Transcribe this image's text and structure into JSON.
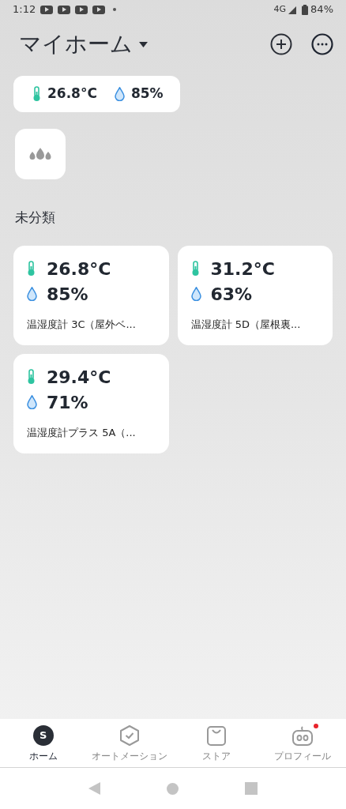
{
  "status_bar": {
    "time": "1:12",
    "notifications": [
      {
        "kind": "video"
      },
      {
        "kind": "video"
      },
      {
        "kind": "video"
      },
      {
        "kind": "video"
      }
    ],
    "network": "4G",
    "battery": "84%"
  },
  "header": {
    "title": "マイホーム"
  },
  "summary": {
    "temperature": "26.8°C",
    "humidity": "85%"
  },
  "section": {
    "title": "未分類"
  },
  "devices": [
    {
      "temperature": "26.8°C",
      "humidity": "85%",
      "name": "温湿度計 3C（屋外ベ..."
    },
    {
      "temperature": "31.2°C",
      "humidity": "63%",
      "name": "温湿度計 5D（屋根裏..."
    },
    {
      "temperature": "29.4°C",
      "humidity": "71%",
      "name": "温湿度計プラス 5A（..."
    }
  ],
  "nav": [
    {
      "kind": "home",
      "label": "ホーム",
      "icon_letter": "S",
      "selected": true,
      "badge": false
    },
    {
      "kind": "automation",
      "label": "オートメーション",
      "selected": false,
      "badge": false
    },
    {
      "kind": "store",
      "label": "ストア",
      "selected": false,
      "badge": false
    },
    {
      "kind": "profile",
      "label": "プロフィール",
      "selected": false,
      "badge": true
    }
  ]
}
